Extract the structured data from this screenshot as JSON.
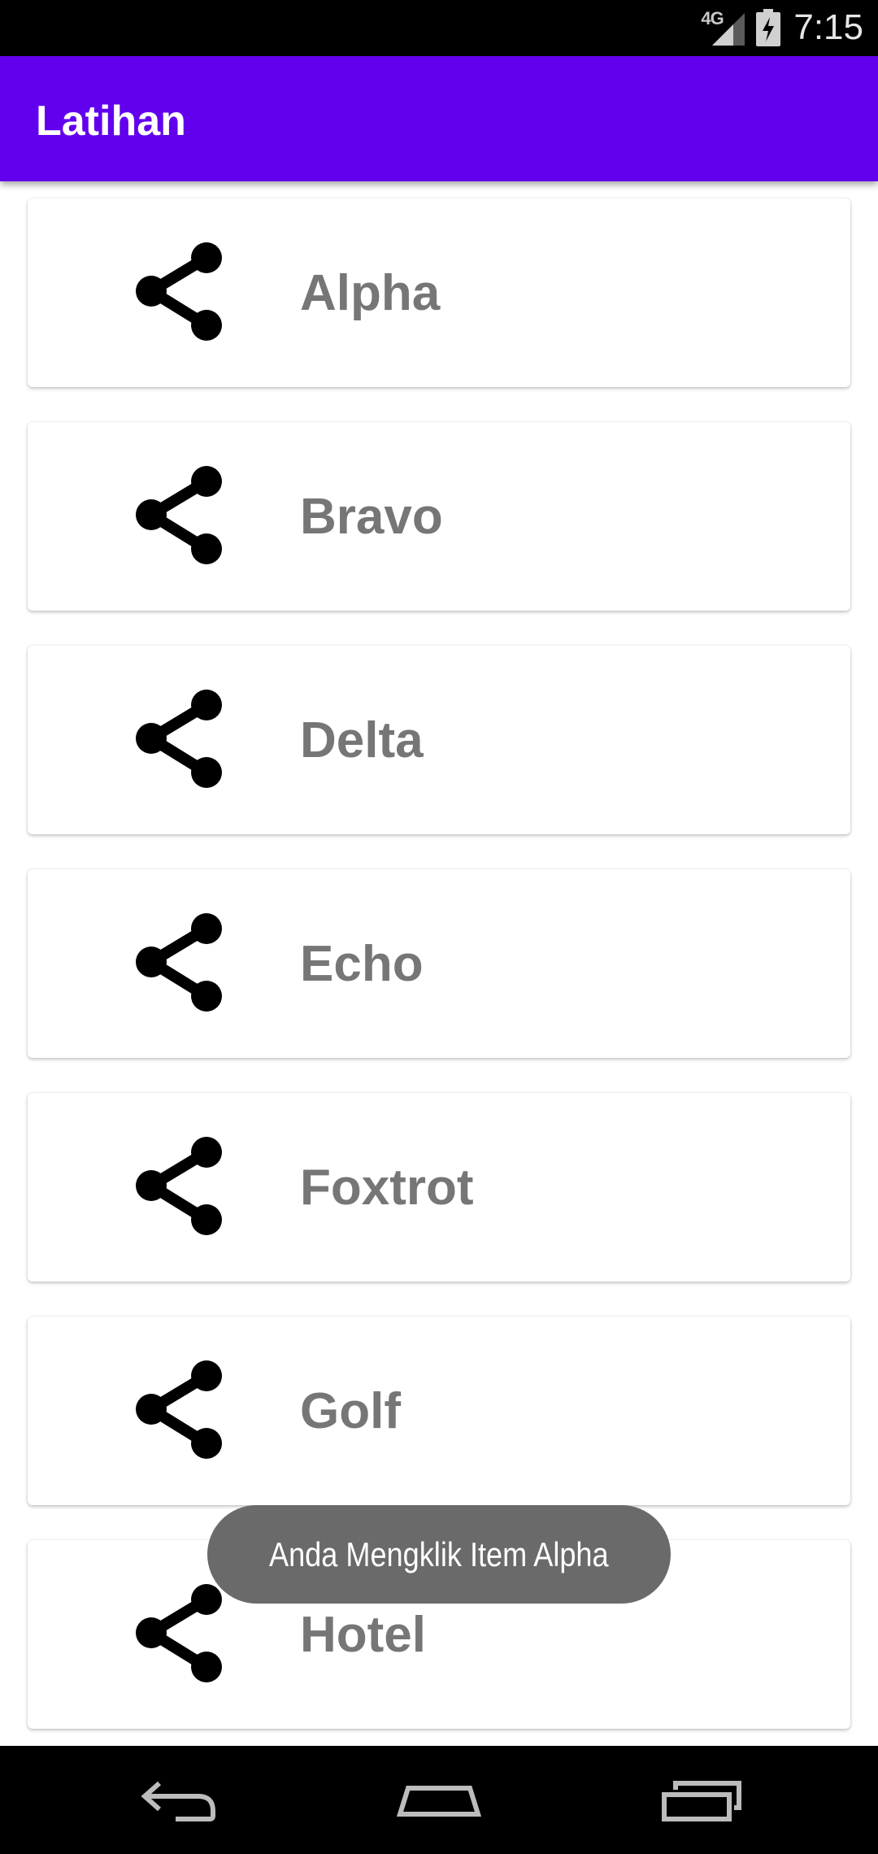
{
  "status_bar": {
    "network_label": "4G",
    "time": "7:15"
  },
  "app_bar": {
    "title": "Latihan"
  },
  "list": {
    "items": [
      {
        "label": "Alpha",
        "icon": "share-icon"
      },
      {
        "label": "Bravo",
        "icon": "share-icon"
      },
      {
        "label": "Delta",
        "icon": "share-icon"
      },
      {
        "label": "Echo",
        "icon": "share-icon"
      },
      {
        "label": "Foxtrot",
        "icon": "share-icon"
      },
      {
        "label": "Golf",
        "icon": "share-icon"
      },
      {
        "label": "Hotel",
        "icon": "share-icon"
      }
    ]
  },
  "toast": {
    "message": "Anda Mengklik Item Alpha"
  },
  "navigation": {
    "buttons": [
      "back-icon",
      "home-icon",
      "recents-icon"
    ]
  },
  "colors": {
    "app_bar": "#6200ee",
    "label_text": "#767676",
    "toast_bg": "#646464"
  }
}
